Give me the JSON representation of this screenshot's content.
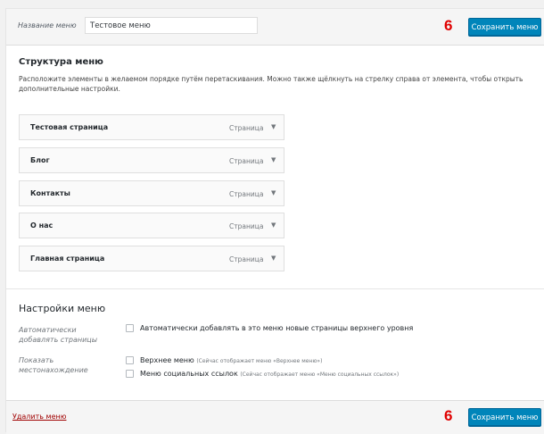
{
  "header": {
    "menu_name_label": "Название меню",
    "menu_name_value": "Тестовое меню",
    "badge": "6",
    "save_label": "Сохранить меню"
  },
  "structure": {
    "title": "Структура меню",
    "description": "Расположите элементы в желаемом порядке путём перетаскивания. Можно также щёлкнуть на стрелку справа от элемента, чтобы открыть дополнительные настройки.",
    "items": [
      {
        "title": "Тестовая страница",
        "type": "Страница"
      },
      {
        "title": "Блог",
        "type": "Страница"
      },
      {
        "title": "Контакты",
        "type": "Страница"
      },
      {
        "title": "О нас",
        "type": "Страница"
      },
      {
        "title": "Главная страница",
        "type": "Страница"
      }
    ]
  },
  "settings": {
    "title": "Настройки меню",
    "auto_add_label_1": "Автоматически",
    "auto_add_label_2": "добавлять страницы",
    "auto_add_option": "Автоматически добавлять в это меню новые страницы верхнего уровня",
    "location_label_1": "Показать",
    "location_label_2": "местонахождение",
    "location_top": "Верхнее меню",
    "location_top_hint": "(Сейчас отображает меню «Верхнее меню»)",
    "location_social": "Меню социальных ссылок",
    "location_social_hint": "(Сейчас отображает меню «Меню социальных ссылок»)"
  },
  "footer": {
    "delete_label": "Удалить меню",
    "badge": "6",
    "save_label": "Сохранить меню"
  },
  "icons": {
    "item_arrow": "arrow-down-icon"
  },
  "colors": {
    "primary_button": "#0085ba",
    "badge": "#e00000",
    "delete_link": "#a00000"
  }
}
